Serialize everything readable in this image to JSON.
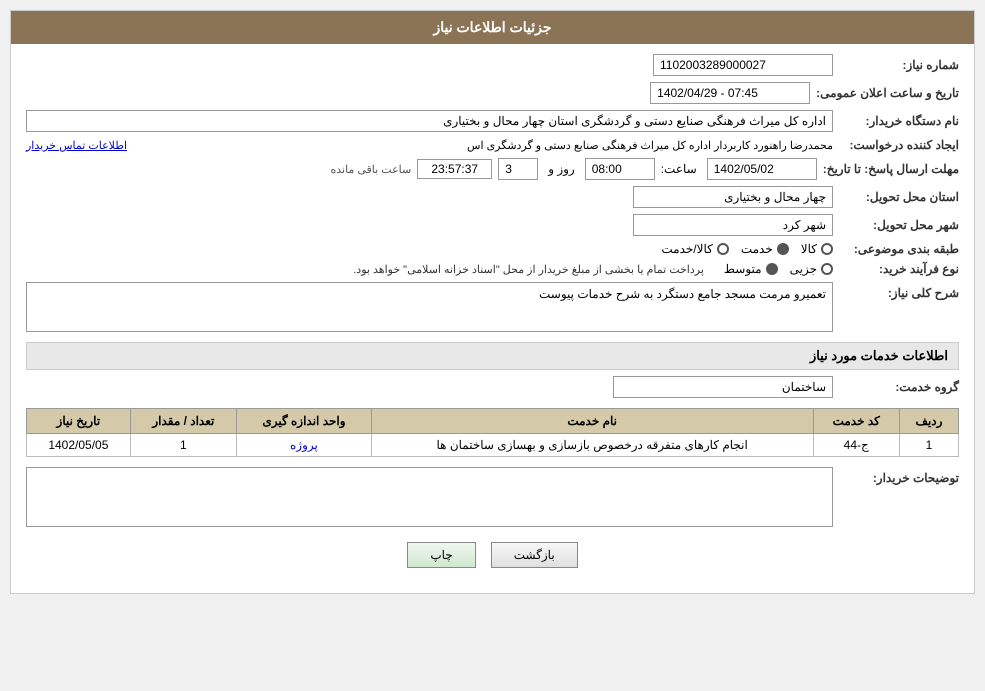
{
  "header": {
    "title": "جزئیات اطلاعات نیاز"
  },
  "fields": {
    "shomareNiaz_label": "شماره نیاز:",
    "shomareNiaz_value": "1102003289000027",
    "namDasgah_label": "نام دستگاه خریدار:",
    "namDasgah_value": "اداره کل میراث فرهنگی  صنایع دستی و گردشگری استان چهار محال و بختیاری",
    "ejadKonande_label": "ایجاد کننده درخواست:",
    "ejadKonande_value": "محمدرضا راهنورد کاربردار اداره کل میراث فرهنگی  صنایع دستی و گردشگری اس",
    "ejadKonande_link": "اطلاعات تماس خریدار",
    "tarikh_label": "تاریخ و ساعت اعلان عمومی:",
    "tarikh_value": "1402/04/29 - 07:45",
    "mohlatErsal_label": "مهلت ارسال پاسخ: تا تاریخ:",
    "mohlatDate": "1402/05/02",
    "mohlatSaat_label": "ساعت:",
    "mohlatSaat": "08:00",
    "mohlatRooz_label": "روز و",
    "mohlatRooz": "3",
    "mohlatMande_label": "ساعت باقی مانده",
    "mohlatMande": "23:57:37",
    "ostan_label": "استان محل تحویل:",
    "ostan_value": "چهار محال و بختیاری",
    "shahr_label": "شهر محل تحویل:",
    "shahr_value": "شهر کرد",
    "tabaqe_label": "طبقه بندی موضوعی:",
    "tabaqe_kala": "کالا",
    "tabaqe_khedmat": "خدمت",
    "tabaqe_kalaKhedmat": "کالا/خدمت",
    "tabaqe_selected": "خدمت",
    "noeFarayand_label": "نوع فرآیند خرید:",
    "noeFarayand_jezzi": "جزیی",
    "noeFarayand_mottaset": "متوسط",
    "noeFarayand_desc": "پرداخت تمام یا بخشی از مبلغ خریدار از محل \"اسناد خزانه اسلامی\" خواهد بود.",
    "sharh_label": "شرح کلی نیاز:",
    "sharh_value": "تعمیرو مرمت مسجد جامع دستگرد به شرح خدمات پیوست",
    "khedmatSection_title": "اطلاعات خدمات مورد نیاز",
    "groheKhedmat_label": "گروه خدمت:",
    "groheKhedmat_value": "ساختمان",
    "table": {
      "headers": [
        "ردیف",
        "کد خدمت",
        "نام خدمت",
        "واحد اندازه گیری",
        "تعداد / مقدار",
        "تاریخ نیاز"
      ],
      "rows": [
        {
          "radif": "1",
          "kodKhedmat": "ج-44",
          "namKhedmat": "انجام کارهای متفرقه درخصوص بازسازی و بهسازی ساختمان ها",
          "vahed": "پروژه",
          "tedad": "1",
          "tarikh": "1402/05/05"
        }
      ]
    },
    "tozihat_label": "توضیحات خریدار:",
    "tozihat_value": "",
    "btn_bazgasht": "بازگشت",
    "btn_chap": "چاپ"
  }
}
